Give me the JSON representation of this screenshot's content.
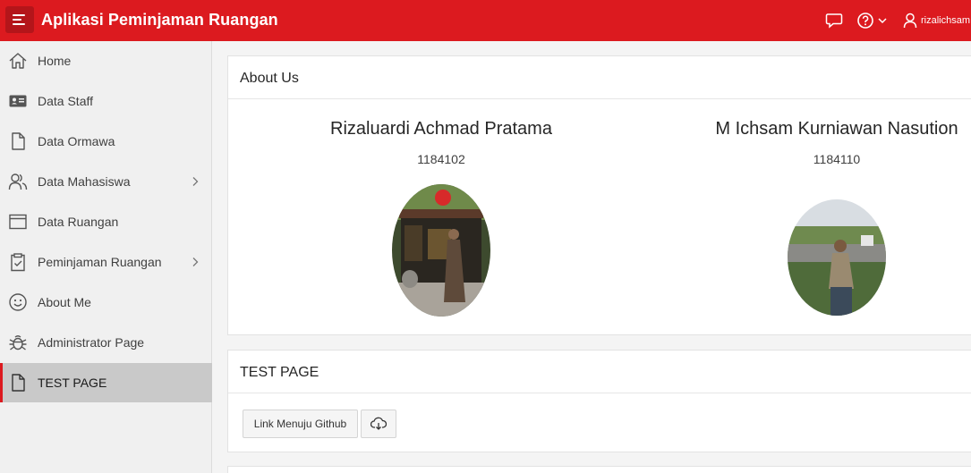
{
  "header": {
    "app_title": "Aplikasi Peminjaman Ruangan",
    "user_name": "rizalichsam",
    "icons": [
      "menu-icon",
      "chat-icon",
      "help-icon",
      "user-icon"
    ]
  },
  "sidebar": {
    "items": [
      {
        "label": "Home",
        "icon": "home-icon"
      },
      {
        "label": "Data Staff",
        "icon": "id-card-icon"
      },
      {
        "label": "Data Ormawa",
        "icon": "file-icon"
      },
      {
        "label": "Data Mahasiswa",
        "icon": "users-icon",
        "has_children": true
      },
      {
        "label": "Data Ruangan",
        "icon": "window-icon"
      },
      {
        "label": "Peminjaman Ruangan",
        "icon": "clipboard-icon",
        "has_children": true
      },
      {
        "label": "About Me",
        "icon": "smile-icon"
      },
      {
        "label": "Administrator Page",
        "icon": "bug-icon"
      },
      {
        "label": "TEST PAGE",
        "icon": "file-icon",
        "active": true
      }
    ]
  },
  "about": {
    "title": "About Us",
    "people": [
      {
        "name": "Rizaluardi Achmad Pratama",
        "id": "1184102"
      },
      {
        "name": "M Ichsam Kurniawan Nasution",
        "id": "1184110"
      }
    ]
  },
  "test_page": {
    "title": "TEST PAGE",
    "link_button": "Link Menuju Github"
  },
  "colors": {
    "brand_red": "#dc1a1f",
    "active_nav": "#c9c9c9"
  }
}
